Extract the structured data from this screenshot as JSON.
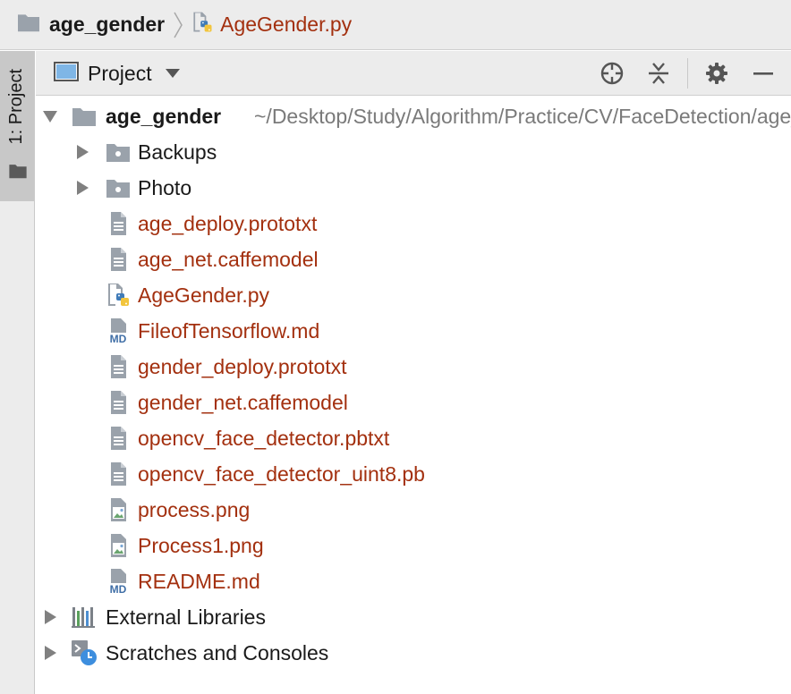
{
  "breadcrumb": {
    "root_label": "age_gender",
    "file_label": "AgeGender.py"
  },
  "side_strip": {
    "tab_label": "1: Project"
  },
  "project_header": {
    "title": "Project"
  },
  "tree": {
    "root": {
      "name": "age_gender",
      "path": "~/Desktop/Study/Algorithm/Practice/CV/FaceDetection/age_gender"
    },
    "folders": [
      {
        "name": "Backups"
      },
      {
        "name": "Photo"
      }
    ],
    "files": [
      {
        "name": "age_deploy.prototxt",
        "icon": "text-file-icon"
      },
      {
        "name": "age_net.caffemodel",
        "icon": "text-file-icon"
      },
      {
        "name": "AgeGender.py",
        "icon": "python-file-icon"
      },
      {
        "name": "FileofTensorflow.md",
        "icon": "markdown-file-icon"
      },
      {
        "name": "gender_deploy.prototxt",
        "icon": "text-file-icon"
      },
      {
        "name": "gender_net.caffemodel",
        "icon": "text-file-icon"
      },
      {
        "name": "opencv_face_detector.pbtxt",
        "icon": "text-file-icon"
      },
      {
        "name": "opencv_face_detector_uint8.pb",
        "icon": "text-file-icon"
      },
      {
        "name": "process.png",
        "icon": "image-file-icon"
      },
      {
        "name": "Process1.png",
        "icon": "image-file-icon"
      },
      {
        "name": "README.md",
        "icon": "markdown-file-icon"
      }
    ],
    "external_libraries": "External Libraries",
    "scratches": "Scratches and Consoles",
    "md_badge": "MD"
  },
  "colors": {
    "modified_file": "#a3300f",
    "folder_gray": "#9aa2ab",
    "panel_bg": "#ececec"
  }
}
